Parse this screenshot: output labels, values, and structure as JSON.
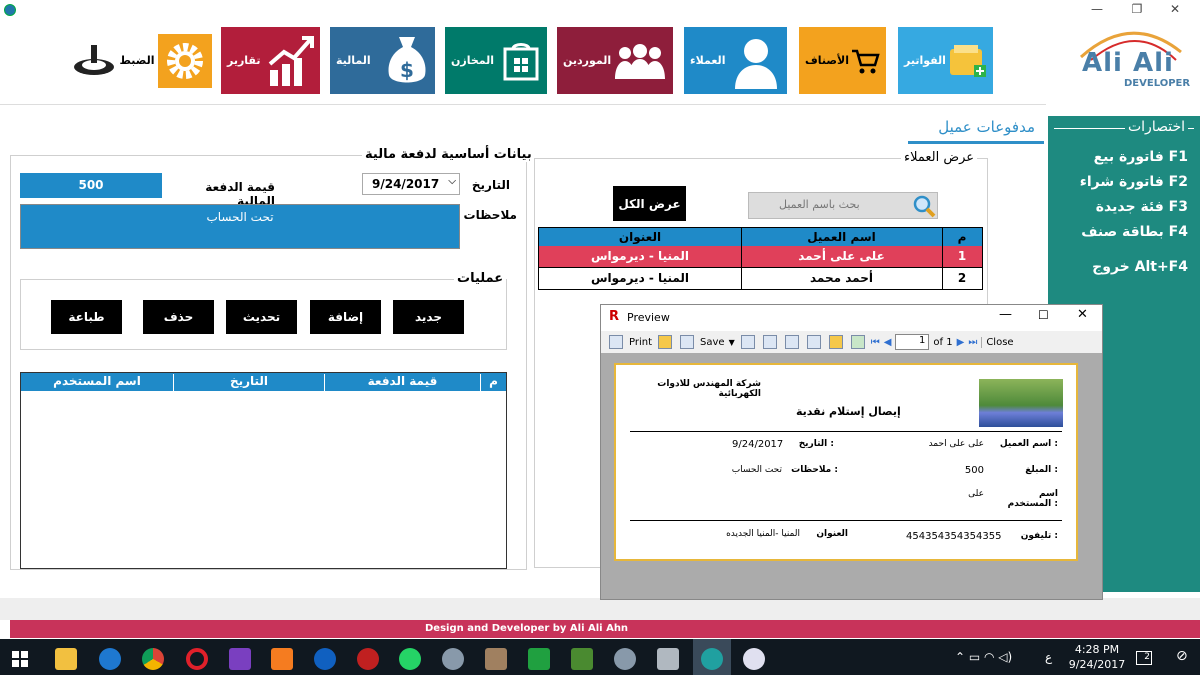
{
  "window": {
    "min": "—",
    "max": "❐",
    "close": "✕"
  },
  "logo": {
    "line1": "Ali Ali",
    "line2": "DEVELOPER"
  },
  "nav": [
    {
      "label": "الفواتير",
      "color": "#36A9E1",
      "icon": "invoice-icon"
    },
    {
      "label": "الأصناف",
      "color": "#F3A21E",
      "icon": "cart-icon"
    },
    {
      "label": "العملاء",
      "color": "#1F8AC8",
      "icon": "customer-icon"
    },
    {
      "label": "الموردين",
      "color": "#8E1E3B",
      "icon": "suppliers-icon"
    },
    {
      "label": "المخازن",
      "color": "#007A6A",
      "icon": "store-icon"
    },
    {
      "label": "المالية",
      "color": "#2F6B9A",
      "icon": "money-bag-icon"
    },
    {
      "label": "تقارير",
      "color": "#B21E3B",
      "icon": "chart-icon"
    },
    {
      "label": "الضبط",
      "color": "#FFFFFF",
      "icon": "gear-icon"
    }
  ],
  "page": {
    "title": "مدفوعات عميل"
  },
  "shortcuts": {
    "title": "اختصارات",
    "items": [
      "فاتورة بيع  F1",
      "فاتورة شراء  F2",
      "فئة جديدة  F3",
      "بطاقة صنف  F4",
      "خروج  Alt+F4"
    ]
  },
  "payment": {
    "group_title": "بيانات أساسية لدفعة مالية",
    "date_label": "التاريخ",
    "date_value": "9/24/2017",
    "amount_label": "قيمة الدفعة المالية",
    "amount_value": "500",
    "notes_label": "ملاحظات",
    "notes_value": "تحت الحساب"
  },
  "operations": {
    "group_title": "عمليات",
    "buttons": [
      "جديد",
      "إضافة",
      "تحديث",
      "حذف",
      "طباعة"
    ]
  },
  "payments_table": {
    "headers": [
      "م",
      "قيمة الدفعة",
      "التاريخ",
      "اسم المستخدم"
    ]
  },
  "customers": {
    "group_title": "عرض العملاء",
    "show_all": "عرض الكل",
    "search_placeholder": "بحث باسم العميل",
    "headers": [
      "م",
      "اسم العميل",
      "العنوان"
    ],
    "rows": [
      {
        "n": "1",
        "name": "على على أحمد",
        "address": "المنيا - ديرمواس"
      },
      {
        "n": "2",
        "name": "أحمد محمد",
        "address": "المنيا - ديرمواس"
      }
    ]
  },
  "preview": {
    "title": "Preview",
    "toolbar": {
      "print": "Print",
      "save": "Save",
      "page": "1",
      "of": "of 1",
      "close": "Close"
    },
    "report": {
      "company": "شركة المهندس للادوات الكهربائية",
      "doc_title": "إيصال إستلام نقدية",
      "customer_label": "اسم العميل :",
      "customer_value": "على على احمد",
      "date_label": "التاريخ :",
      "date_value": "9/24/2017",
      "amount_label": "المبلغ :",
      "amount_value": "500",
      "notes_label": "ملاحظات :",
      "notes_value": "تحت الحساب",
      "user_label": "اسم المستخدم :",
      "user_value": "على",
      "phone_label": "تليفون :",
      "phone_value": "454354354354355",
      "address_label": "العنوان",
      "address_value": "المنيا -المنيا الجديده"
    }
  },
  "footer": {
    "credit": "Design and Developer by Ali Ali Ahn"
  },
  "taskbar": {
    "time": "4:28 PM",
    "date": "9/24/2017",
    "lang": "ع",
    "notif": "2"
  }
}
